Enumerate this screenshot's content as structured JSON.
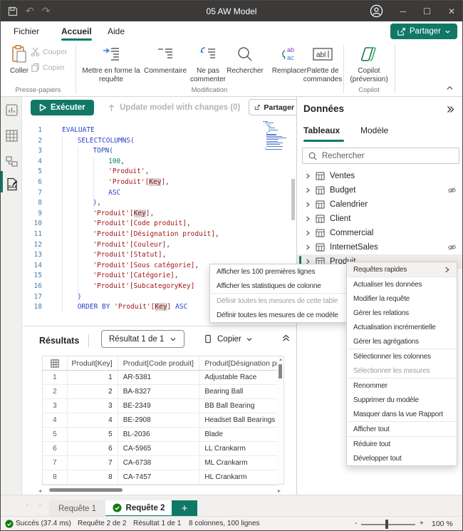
{
  "window": {
    "title": "05 AW Model"
  },
  "menubar": {
    "items": [
      "Fichier",
      "Accueil",
      "Aide"
    ],
    "active": "Accueil",
    "share_label": "Partager"
  },
  "ribbon": {
    "clipboard": {
      "paste": "Coller",
      "cut": "Couper",
      "copy": "Copier",
      "group_label": "Presse-papiers"
    },
    "edit": {
      "format": "Mettre en forme la requête",
      "comment": "Commentaire",
      "uncomment": "Ne pas commenter",
      "find": "Rechercher",
      "replace": "Remplacer",
      "palette": "Palette de commandes",
      "group_label": "Modification"
    },
    "copilot": {
      "button": "Copilot (préversion)",
      "group_label": "Copilot"
    }
  },
  "toolbar": {
    "run": "Exécuter",
    "update": "Update model with changes (0)",
    "share": "Partager"
  },
  "code": {
    "indents": [
      0,
      1,
      2,
      3,
      3,
      3,
      3,
      2,
      2,
      2,
      2,
      2,
      2,
      2,
      2,
      2,
      1,
      1
    ],
    "lines": [
      [
        [
          "kw",
          "EVALUATE"
        ]
      ],
      [
        [
          "kw",
          "SELECTCOLUMNS("
        ]
      ],
      [
        [
          "kw",
          "TOPN("
        ]
      ],
      [
        [
          "num",
          "100"
        ],
        [
          "pl",
          ","
        ]
      ],
      [
        [
          "str",
          "'Produit'"
        ],
        [
          "pl",
          ","
        ]
      ],
      [
        [
          "str",
          "'Produit'["
        ],
        [
          "hl",
          "Key"
        ],
        [
          "str",
          "]"
        ],
        [
          "pl",
          ","
        ]
      ],
      [
        [
          "kw",
          "ASC"
        ]
      ],
      [
        [
          "kw",
          ")"
        ],
        [
          "pl",
          ","
        ]
      ],
      [
        [
          "str",
          "'Produit'["
        ],
        [
          "hl",
          "Key"
        ],
        [
          "str",
          "]"
        ],
        [
          "pl",
          ","
        ]
      ],
      [
        [
          "str",
          "'Produit'[Code produit]"
        ],
        [
          "pl",
          ","
        ]
      ],
      [
        [
          "str",
          "'Produit'[Désignation produit]"
        ],
        [
          "pl",
          ","
        ]
      ],
      [
        [
          "str",
          "'Produit'[Couleur]"
        ],
        [
          "pl",
          ","
        ]
      ],
      [
        [
          "str",
          "'Produit'[Statut]"
        ],
        [
          "pl",
          ","
        ]
      ],
      [
        [
          "str",
          "'Produit'[Sous catégorie]"
        ],
        [
          "pl",
          ","
        ]
      ],
      [
        [
          "str",
          "'Produit'[Catégorie]"
        ],
        [
          "pl",
          ","
        ]
      ],
      [
        [
          "str",
          "'Produit'[SubcategoryKey]"
        ]
      ],
      [
        [
          "kw",
          ")"
        ]
      ],
      [
        [
          "kw",
          "ORDER BY "
        ],
        [
          "str",
          "'Produit'["
        ],
        [
          "hl",
          "Key"
        ],
        [
          "str",
          "]"
        ],
        [
          "pl",
          " "
        ],
        [
          "kw",
          "ASC"
        ]
      ]
    ]
  },
  "results": {
    "title": "Résultats",
    "result_nav": "Résultat 1 de 1",
    "copy_label": "Copier",
    "columns": [
      "Produit[Key]",
      "Produit[Code produit]",
      "Produit[Désignation pro.."
    ],
    "rows": [
      [
        "1",
        "1",
        "AR-5381",
        "Adjustable Race"
      ],
      [
        "2",
        "2",
        "BA-8327",
        "Bearing Ball"
      ],
      [
        "3",
        "3",
        "BE-2349",
        "BB Ball Bearing"
      ],
      [
        "4",
        "4",
        "BE-2908",
        "Headset Ball Bearings"
      ],
      [
        "5",
        "5",
        "BL-2036",
        "Blade"
      ],
      [
        "6",
        "6",
        "CA-5965",
        "LL Crankarm"
      ],
      [
        "7",
        "7",
        "CA-6738",
        "ML Crankarm"
      ],
      [
        "8",
        "8",
        "CA-7457",
        "HL Crankarm"
      ]
    ]
  },
  "data_panel": {
    "title": "Données",
    "tabs": [
      "Tableaux",
      "Modèle"
    ],
    "active_tab": "Tableaux",
    "search_placeholder": "Rechercher",
    "tables": [
      {
        "label": "Ventes"
      },
      {
        "label": "Budget",
        "hidden": true
      },
      {
        "label": "Calendrier"
      },
      {
        "label": "Client"
      },
      {
        "label": "Commercial"
      },
      {
        "label": "InternetSales",
        "hidden": true
      },
      {
        "label": "Produit",
        "selected": true
      }
    ]
  },
  "menu1": {
    "items": [
      {
        "label": "Afficher les 100 premières lignes"
      },
      {
        "label": "Afficher les statistiques de colonne",
        "divider_after": true
      },
      {
        "label": "Définir toutes les mesures de cette table",
        "disabled": true
      },
      {
        "label": "Définir toutes les mesures de ce modèle"
      }
    ]
  },
  "menu2": {
    "items": [
      {
        "label": "Requêtes rapides",
        "submenu": true,
        "hover": true,
        "divider_after": true
      },
      {
        "label": "Actualiser les données"
      },
      {
        "label": "Modifier la requête"
      },
      {
        "label": "Gérer les relations"
      },
      {
        "label": "Actualisation incrémentielle"
      },
      {
        "label": "Gérer les agrégations",
        "divider_after": true
      },
      {
        "label": "Sélectionner les colonnes"
      },
      {
        "label": "Sélectionner les mesures",
        "disabled": true,
        "divider_after": true
      },
      {
        "label": "Renommer"
      },
      {
        "label": "Supprimer du modèle"
      },
      {
        "label": "Masquer dans la vue Rapport",
        "divider_after": true
      },
      {
        "label": "Afficher tout",
        "divider_after": true
      },
      {
        "label": "Réduire tout"
      },
      {
        "label": "Développer tout"
      }
    ]
  },
  "query_tabs": {
    "tab1": "Requête 1",
    "tab2": "Requête 2"
  },
  "statusbar": {
    "success": "Succès (37.4 ms)",
    "query": "Requête 2 de 2",
    "result": "Résultat 1 de 1",
    "cols": "8 colonnes, 100 lignes",
    "zoom": "100 %"
  },
  "colors": {
    "accent": "#117865",
    "green": "#0f7b0f",
    "keyword": "#2b43c8",
    "number": "#098658",
    "string": "#a31515"
  }
}
